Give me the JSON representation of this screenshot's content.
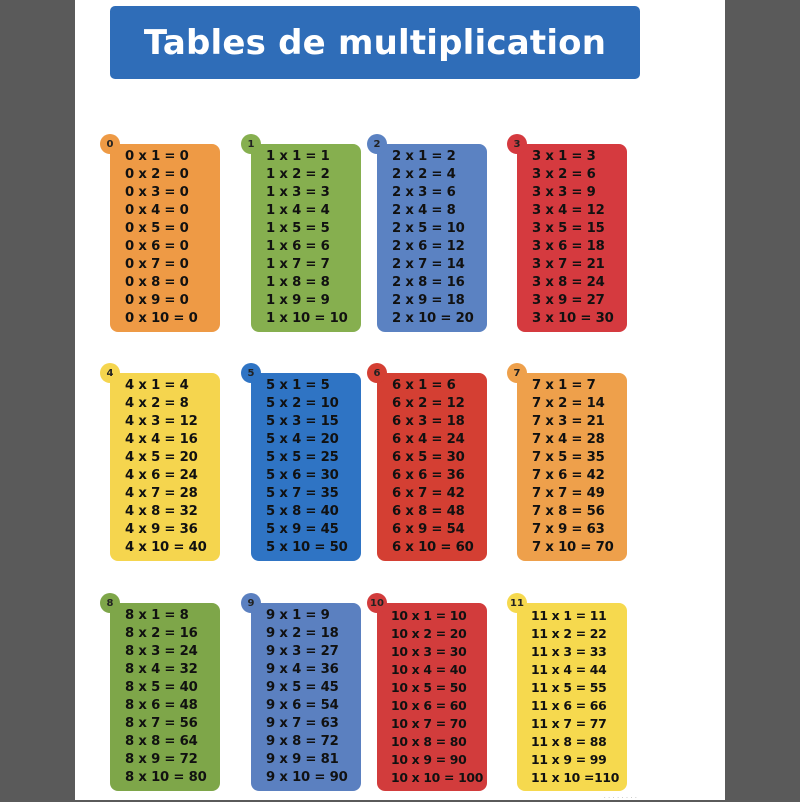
{
  "title": "Tables de multiplication",
  "cards": [
    {
      "badge": "0",
      "color": "#ee9a45",
      "badge_color": "#ee9a45",
      "rows": [
        "0 x 1 = 0",
        "0 x 2 = 0",
        "0 x 3 = 0",
        "0 x 4 = 0",
        "0 x 5 = 0",
        "0 x 6 = 0",
        "0 x 7 = 0",
        "0 x 8 = 0",
        "0 x 9 = 0",
        "0 x 10 = 0"
      ]
    },
    {
      "badge": "1",
      "color": "#86af4f",
      "badge_color": "#86af4f",
      "rows": [
        "1 x 1 = 1",
        "1 x 2 = 2",
        "1 x 3 = 3",
        "1 x 4 = 4",
        "1 x 5 = 5",
        "1 x 6 = 6",
        "1 x 7 = 7",
        "1 x 8 = 8",
        "1 x 9 = 9",
        "1 x 10 = 10"
      ]
    },
    {
      "badge": "2",
      "color": "#5b82c2",
      "badge_color": "#5b82c2",
      "rows": [
        "2 x 1 = 2",
        "2 x 2 = 4",
        "2 x 3 = 6",
        "2 x 4 = 8",
        "2 x 5 = 10",
        "2 x 6 = 12",
        "2 x 7 = 14",
        "2 x 8 = 16",
        "2 x 9 = 18",
        "2 x 10 = 20"
      ]
    },
    {
      "badge": "3",
      "color": "#d53a3f",
      "badge_color": "#d53a3f",
      "rows": [
        "3 x 1 = 3",
        "3 x 2 = 6",
        "3 x 3 = 9",
        "3 x 4 = 12",
        "3 x 5 = 15",
        "3 x 6 = 18",
        "3 x 7 = 21",
        "3 x 8 = 24",
        "3 x 9 = 27",
        "3 x 10 = 30"
      ]
    },
    {
      "badge": "4",
      "color": "#f5d54e",
      "badge_color": "#f5d54e",
      "rows": [
        "4 x 1 = 4",
        "4 x 2 = 8",
        "4 x 3 = 12",
        "4 x 4 = 16",
        "4 x 5 = 20",
        "4 x 6 = 24",
        "4 x 7 = 28",
        "4 x 8 = 32",
        "4 x 9 = 36",
        "4 x 10 = 40"
      ]
    },
    {
      "badge": "5",
      "color": "#2f74c4",
      "badge_color": "#2f74c4",
      "rows": [
        "5 x 1 = 5",
        "5 x 2 = 10",
        "5 x 3 = 15",
        "5 x 4 = 20",
        "5 x 5 = 25",
        "5 x 6 = 30",
        "5 x 7 = 35",
        "5 x 8 = 40",
        "5 x 9 = 45",
        "5 x 10 = 50"
      ]
    },
    {
      "badge": "6",
      "color": "#d43f33",
      "badge_color": "#d43f33",
      "rows": [
        "6 x 1 = 6",
        "6 x 2 = 12",
        "6 x 3 = 18",
        "6 x 4 = 24",
        "6 x 5 = 30",
        "6 x 6 = 36",
        "6 x 7 = 42",
        "6 x 8 = 48",
        "6 x 9 = 54",
        "6 x 10 = 60"
      ]
    },
    {
      "badge": "7",
      "color": "#eea04b",
      "badge_color": "#eea04b",
      "rows": [
        "7 x 1 = 7",
        "7 x 2 = 14",
        "7 x 3 = 21",
        "7 x 4 = 28",
        "7 x 5 = 35",
        "7 x 6 = 42",
        "7 x 7 = 49",
        "7 x 8 = 56",
        "7 x 9 = 63",
        "7 x 10 = 70"
      ]
    },
    {
      "badge": "8",
      "color": "#7ea649",
      "badge_color": "#7ea649",
      "rows": [
        "8 x 1 = 8",
        "8 x 2 = 16",
        "8 x 3 = 24",
        "8 x 4 = 32",
        "8 x 5 = 40",
        "8 x 6 = 48",
        "8 x 7 = 56",
        "8 x 8 = 64",
        "8 x 9 = 72",
        "8 x 10 = 80"
      ]
    },
    {
      "badge": "9",
      "color": "#5b80c0",
      "badge_color": "#5b80c0",
      "rows": [
        "9 x 1 = 9",
        "9 x 2 = 18",
        "9 x 3 = 27",
        "9 x 4 = 36",
        "9 x 5 = 45",
        "9 x 6 = 54",
        "9 x 7 = 63",
        "9 x 8 = 72",
        "9 x 9 = 81",
        "9 x 10 = 90"
      ]
    },
    {
      "badge": "10",
      "color": "#d23c3c",
      "badge_color": "#d23c3c",
      "rows": [
        "10 x 1 = 10",
        "10 x 2 = 20",
        "10 x 3 = 30",
        "10 x 4 = 40",
        "10 x 5 = 50",
        "10 x 6 = 60",
        "10 x 7 = 70",
        "10 x 8 = 80",
        "10 x 9 = 90",
        "10 x 10 = 100"
      ]
    },
    {
      "badge": "11",
      "color": "#f6d94e",
      "badge_color": "#f6d94e",
      "rows": [
        "11 x 1 = 11",
        "11 x 2 = 22",
        "11 x 3 = 33",
        "11 x 4 = 44",
        "11 x 5 = 55",
        "11 x 6 = 66",
        "11 x 7 = 77",
        "11 x 8 = 88",
        "11 x 9 = 99",
        "11 x 10 =110"
      ]
    }
  ]
}
